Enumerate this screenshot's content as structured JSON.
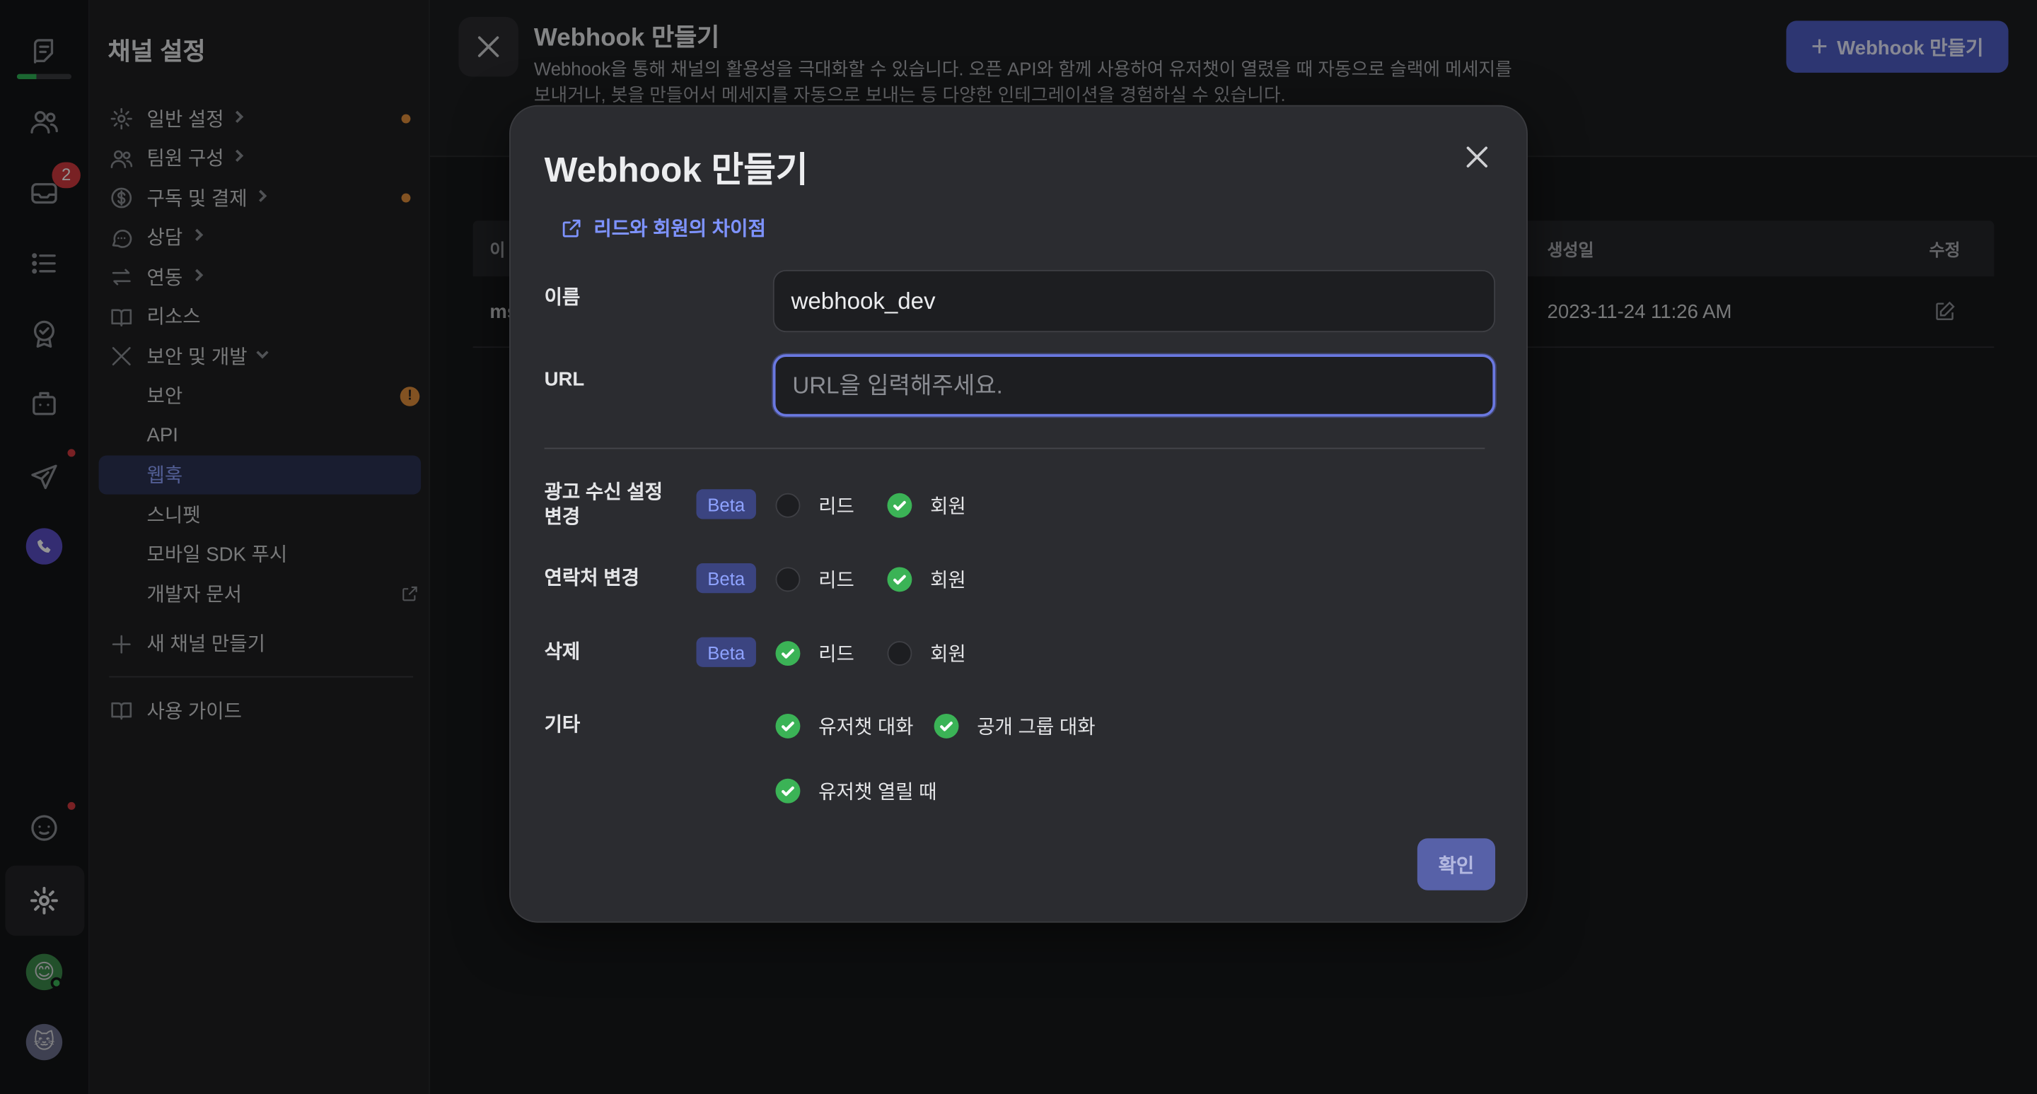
{
  "rail": {
    "inbox_badge": "2",
    "onboarding_progress": 0.35,
    "icons": [
      "channel-logo-icon",
      "people-icon",
      "inbox-icon",
      "list-icon",
      "badge-icon",
      "bot-icon",
      "send-icon",
      "phone-icon",
      "chat-face-icon",
      "settings-icon",
      "user-avatar",
      "channel-avatar"
    ]
  },
  "sidebar": {
    "title": "채널 설정",
    "items": [
      {
        "label": "일반 설정",
        "icon": "gear-icon"
      },
      {
        "label": "팀원 구성",
        "icon": "people-icon"
      },
      {
        "label": "구독 및 결제",
        "icon": "dollar-icon"
      },
      {
        "label": "상담",
        "icon": "chat-bubble-icon"
      },
      {
        "label": "연동",
        "icon": "arrows-icon"
      },
      {
        "label": "리소스",
        "icon": "book-icon"
      },
      {
        "label": "보안 및 개발",
        "icon": "tools-icon"
      }
    ],
    "subitems": [
      {
        "label": "보안"
      },
      {
        "label": "API"
      },
      {
        "label": "웹훅"
      },
      {
        "label": "스니펫"
      },
      {
        "label": "모바일 SDK 푸시"
      },
      {
        "label": "개발자 문서"
      }
    ],
    "warning_mark": "!",
    "new_channel": "새 채널 만들기",
    "guide": "사용 가이드"
  },
  "header": {
    "title": "Webhook 만들기",
    "description": "Webhook을 통해 채널의 활용성을 극대화할 수 있습니다. 오픈 API와 함께 사용하여 유저챗이 열렸을 때 자동으로 슬랙에 메세지를 보내거나, 봇을 만들어서 메세지를 자동으로 보내는 등 다양한 인테그레이션을 경험하실 수 있습니다.",
    "create_button": "Webhook 만들기",
    "create_button_plus": "+"
  },
  "table": {
    "columns": [
      "이",
      "생성일",
      "수정"
    ],
    "rows": [
      {
        "name": "ms",
        "created": "2023-11-24 11:26 AM"
      }
    ]
  },
  "modal": {
    "title": "Webhook 만들기",
    "help_link": "리드와 회원의 차이점",
    "name_label": "이름",
    "name_value": "webhook_dev",
    "url_label": "URL",
    "url_placeholder": "URL을 입력해주세요.",
    "beta_label": "Beta",
    "rows": [
      {
        "label": "광고 수신 설정 변경",
        "lead_label": "리드",
        "lead_checked": false,
        "member_label": "회원",
        "member_checked": true
      },
      {
        "label": "연락처 변경",
        "lead_label": "리드",
        "lead_checked": false,
        "member_label": "회원",
        "member_checked": true
      },
      {
        "label": "삭제",
        "lead_label": "리드",
        "lead_checked": true,
        "member_label": "회원",
        "member_checked": false
      }
    ],
    "other": {
      "label": "기타",
      "options": [
        {
          "label": "유저챗 대화",
          "checked": true
        },
        {
          "label": "공개 그룹 대화",
          "checked": true
        },
        {
          "label": "유저챗 열릴 때",
          "checked": true
        }
      ]
    },
    "confirm_button": "확인"
  },
  "colors": {
    "accent": "#4f5ec4",
    "check_on": "#3bb356",
    "warning": "#e08e3c",
    "badge": "#d0393f"
  }
}
